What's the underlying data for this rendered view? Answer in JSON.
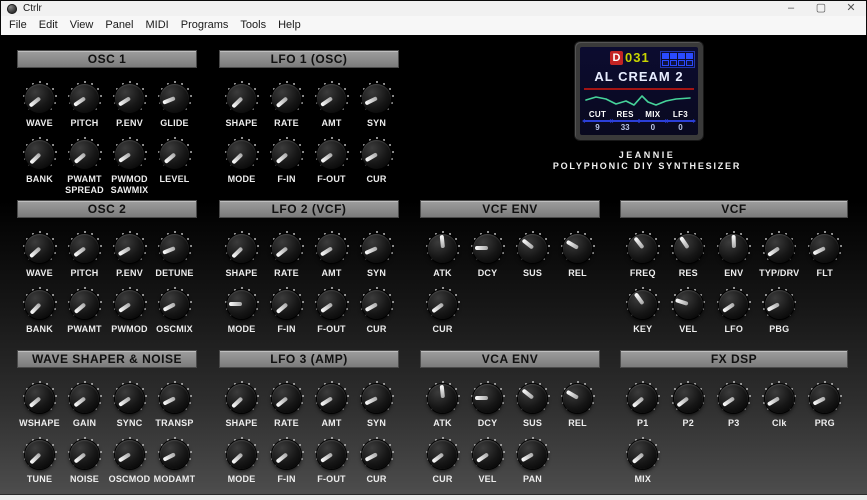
{
  "window": {
    "title": "Ctrlr",
    "minimize_glyph": "–",
    "maximize_glyph": "▢",
    "close_glyph": "✕"
  },
  "menubar": {
    "items": [
      "File",
      "Edit",
      "View",
      "Panel",
      "MIDI",
      "Programs",
      "Tools",
      "Help"
    ]
  },
  "display": {
    "program_letter": "D",
    "program_number": "031",
    "patch_name": "AL CREAM 2",
    "bank_grid": [
      1,
      1,
      1,
      1,
      0,
      0,
      0,
      0
    ],
    "params": [
      {
        "label": "CUT",
        "value": "9"
      },
      {
        "label": "RES",
        "value": "33"
      },
      {
        "label": "MIX",
        "value": "0"
      },
      {
        "label": "LF3",
        "value": "0"
      }
    ]
  },
  "branding": {
    "line1": "JEANNIE",
    "line2": "POLYPHONIC DIY SYNTHESIZER"
  },
  "colors": {
    "screen_bg": "#0c0c30",
    "program_red": "#c32424",
    "program_yellow": "#c8d400",
    "underline_blue": "#2b3fd8",
    "wave_green": "#46d39a",
    "divider_red": "#a31414",
    "header_gray": "#8e8e8e"
  },
  "panel": {
    "sections": [
      {
        "id": "osc1",
        "title": "OSC 1",
        "rows": [
          [
            {
              "label": "WAVE",
              "angle": -128
            },
            {
              "label": "PITCH",
              "angle": -124
            },
            {
              "label": "P.ENV",
              "angle": -122
            },
            {
              "label": "GLIDE",
              "angle": -112
            }
          ],
          [
            {
              "label": "BANK",
              "angle": -134
            },
            {
              "label": "PWAMT SPREAD",
              "angle": -130
            },
            {
              "label": "PWMOD SAWMIX",
              "angle": -124
            },
            {
              "label": "LEVEL",
              "angle": -130
            }
          ]
        ]
      },
      {
        "id": "lfo1",
        "title": "LFO 1 (OSC)",
        "rows": [
          [
            {
              "label": "SHAPE",
              "angle": -134
            },
            {
              "label": "RATE",
              "angle": -130
            },
            {
              "label": "AMT",
              "angle": -124
            },
            {
              "label": "SYN",
              "angle": -116
            }
          ],
          [
            {
              "label": "MODE",
              "angle": -134
            },
            {
              "label": "F-IN",
              "angle": -130
            },
            {
              "label": "F-OUT",
              "angle": -126
            },
            {
              "label": "CUR",
              "angle": -120
            }
          ]
        ]
      },
      {
        "id": "osc2",
        "title": "OSC 2",
        "rows": [
          [
            {
              "label": "WAVE",
              "angle": -132
            },
            {
              "label": "PITCH",
              "angle": -126
            },
            {
              "label": "P.ENV",
              "angle": -120
            },
            {
              "label": "DETUNE",
              "angle": -112
            }
          ],
          [
            {
              "label": "BANK",
              "angle": -136
            },
            {
              "label": "PWAMT",
              "angle": -130
            },
            {
              "label": "PWMOD",
              "angle": -124
            },
            {
              "label": "OSCMIX",
              "angle": -118
            }
          ]
        ]
      },
      {
        "id": "lfo2",
        "title": "LFO 2 (VCF)",
        "rows": [
          [
            {
              "label": "SHAPE",
              "angle": -134
            },
            {
              "label": "RATE",
              "angle": -128
            },
            {
              "label": "AMT",
              "angle": -122
            },
            {
              "label": "SYN",
              "angle": -114
            }
          ],
          [
            {
              "label": "MODE",
              "angle": -90
            },
            {
              "label": "F-IN",
              "angle": -130
            },
            {
              "label": "F-OUT",
              "angle": -125
            },
            {
              "label": "CUR",
              "angle": -119
            }
          ]
        ]
      },
      {
        "id": "vcfenv",
        "title": "VCF ENV",
        "rows": [
          [
            {
              "label": "ATK",
              "angle": -6
            },
            {
              "label": "DCY",
              "angle": -90
            },
            {
              "label": "SUS",
              "angle": -52
            },
            {
              "label": "REL",
              "angle": -60
            }
          ],
          [
            {
              "label": "CUR",
              "angle": -126
            }
          ]
        ]
      },
      {
        "id": "vcf",
        "title": "VCF",
        "rows": [
          [
            {
              "label": "FREQ",
              "angle": -38
            },
            {
              "label": "RES",
              "angle": -34
            },
            {
              "label": "ENV",
              "angle": -2
            },
            {
              "label": "TYP/DRV",
              "angle": -124
            },
            {
              "label": "FLT",
              "angle": -116
            }
          ],
          [
            {
              "label": "KEY",
              "angle": -36
            },
            {
              "label": "VEL",
              "angle": -72
            },
            {
              "label": "LFO",
              "angle": -124
            },
            {
              "label": "PBG",
              "angle": -118
            }
          ]
        ]
      },
      {
        "id": "shaper",
        "title": "WAVE SHAPER & NOISE",
        "rows": [
          [
            {
              "label": "WSHAPE",
              "angle": -130
            },
            {
              "label": "GAIN",
              "angle": -127
            },
            {
              "label": "SYNC",
              "angle": -124
            },
            {
              "label": "TRANSP",
              "angle": -117
            }
          ],
          [
            {
              "label": "TUNE",
              "angle": -134
            },
            {
              "label": "NOISE",
              "angle": -128
            },
            {
              "label": "OSCMOD",
              "angle": -122
            },
            {
              "label": "MODAMT",
              "angle": -117
            }
          ]
        ]
      },
      {
        "id": "lfo3",
        "title": "LFO 3 (AMP)",
        "rows": [
          [
            {
              "label": "SHAPE",
              "angle": -133
            },
            {
              "label": "RATE",
              "angle": -128
            },
            {
              "label": "AMT",
              "angle": -122
            },
            {
              "label": "SYN",
              "angle": -116
            }
          ],
          [
            {
              "label": "MODE",
              "angle": -133
            },
            {
              "label": "F-IN",
              "angle": -128
            },
            {
              "label": "F-OUT",
              "angle": -124
            },
            {
              "label": "CUR",
              "angle": -118
            }
          ]
        ]
      },
      {
        "id": "vcaenv",
        "title": "VCA ENV",
        "rows": [
          [
            {
              "label": "ATK",
              "angle": -6
            },
            {
              "label": "DCY",
              "angle": -90
            },
            {
              "label": "SUS",
              "angle": -52
            },
            {
              "label": "REL",
              "angle": -60
            }
          ],
          [
            {
              "label": "CUR",
              "angle": -127
            },
            {
              "label": "VEL",
              "angle": -124
            },
            {
              "label": "PAN",
              "angle": -120
            }
          ]
        ]
      },
      {
        "id": "fxdsp",
        "title": "FX DSP",
        "rows": [
          [
            {
              "label": "P1",
              "angle": -130
            },
            {
              "label": "P2",
              "angle": -127
            },
            {
              "label": "P3",
              "angle": -124
            },
            {
              "label": "Clk",
              "angle": -121
            },
            {
              "label": "PRG",
              "angle": -117
            }
          ],
          [
            {
              "label": "MIX",
              "angle": -130
            }
          ]
        ]
      }
    ]
  }
}
